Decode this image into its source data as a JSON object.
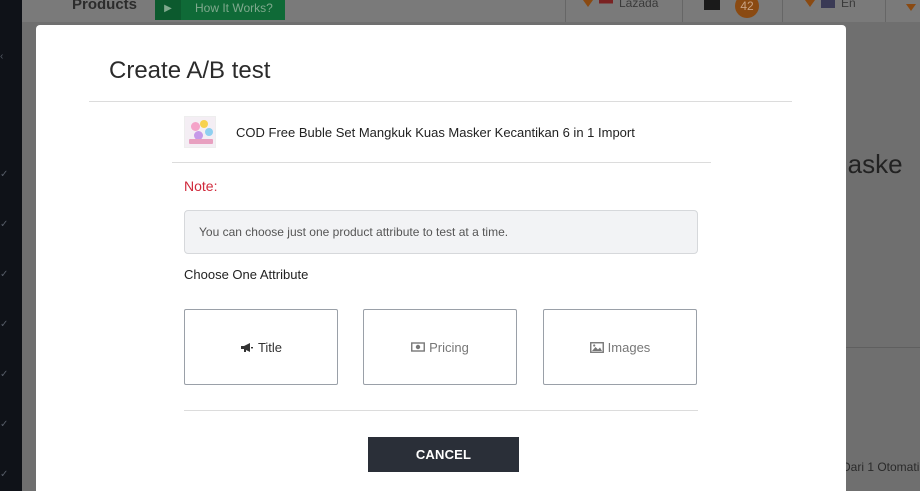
{
  "background": {
    "nav_title": "Products",
    "how_it_works_label": "How It Works?",
    "marketplace_label": "Lazada",
    "notification_count": "42",
    "language_label": "En",
    "page_title_fragment": "s Maske",
    "pagination_fragment": "Dari 1 Otomati"
  },
  "modal": {
    "title": "Create A/B test",
    "product": {
      "name": "COD Free Buble Set Mangkuk Kuas Masker Kecantikan 6 in 1 Import"
    },
    "note_label": "Note:",
    "note_text": "You can choose just one product attribute to test at a time.",
    "choose_label": "Choose One Attribute",
    "attributes": [
      {
        "label": "Title",
        "icon": "megaphone-icon"
      },
      {
        "label": "Pricing",
        "icon": "money-icon"
      },
      {
        "label": "Images",
        "icon": "image-icon"
      }
    ],
    "cancel_label": "CANCEL"
  },
  "colors": {
    "note": "#d0293b",
    "cancel_bg": "#2a2f38",
    "overlay_bg": "#6f6f6f"
  }
}
